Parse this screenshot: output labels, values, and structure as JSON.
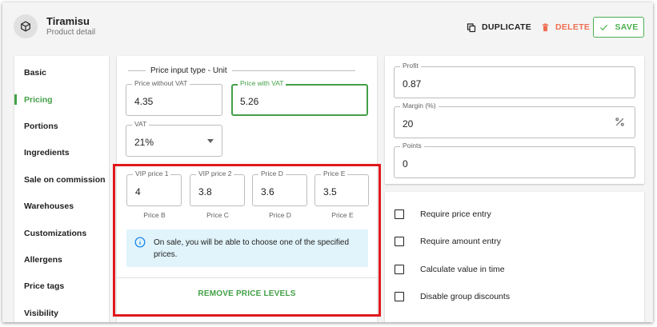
{
  "header": {
    "title": "Tiramisu",
    "subtitle": "Product detail",
    "duplicate_label": "DUPLICATE",
    "delete_label": "DELETE",
    "save_label": "SAVE"
  },
  "sidebar": {
    "items": [
      {
        "label": "Basic",
        "active": false
      },
      {
        "label": "Pricing",
        "active": true
      },
      {
        "label": "Portions",
        "active": false
      },
      {
        "label": "Ingredients",
        "active": false
      },
      {
        "label": "Sale on commission",
        "active": false
      },
      {
        "label": "Warehouses",
        "active": false
      },
      {
        "label": "Customizations",
        "active": false
      },
      {
        "label": "Allergens",
        "active": false
      },
      {
        "label": "Price tags",
        "active": false
      },
      {
        "label": "Visibility",
        "active": false
      }
    ]
  },
  "pricing": {
    "section_title": "Price input type - Unit",
    "price_without_vat": {
      "label": "Price without VAT",
      "value": "4.35"
    },
    "price_with_vat": {
      "label": "Price with VAT",
      "value": "5.26"
    },
    "vat": {
      "label": "VAT",
      "value": "21%"
    },
    "levels": [
      {
        "label": "VIP price 1",
        "value": "4",
        "caption": "Price B"
      },
      {
        "label": "VIP price 2",
        "value": "3.8",
        "caption": "Price C"
      },
      {
        "label": "Price D",
        "value": "3.6",
        "caption": "Price D"
      },
      {
        "label": "Price E",
        "value": "3.5",
        "caption": "Price E"
      }
    ],
    "info_text": "On sale, you will be able to choose one of the specified prices.",
    "remove_label": "REMOVE PRICE LEVELS"
  },
  "stats": {
    "profit": {
      "label": "Profit",
      "value": "0.87"
    },
    "margin": {
      "label": "Margin (%)",
      "value": "20"
    },
    "points": {
      "label": "Points",
      "value": "0"
    }
  },
  "options": [
    {
      "label": "Require price entry",
      "checked": false
    },
    {
      "label": "Require amount entry",
      "checked": false
    },
    {
      "label": "Calculate value in time",
      "checked": false
    },
    {
      "label": "Disable group discounts",
      "checked": false
    }
  ],
  "colors": {
    "accent": "#43a047",
    "danger": "#ef6c50",
    "info_bg": "#e1f4fb",
    "highlight": "#e0191d"
  }
}
